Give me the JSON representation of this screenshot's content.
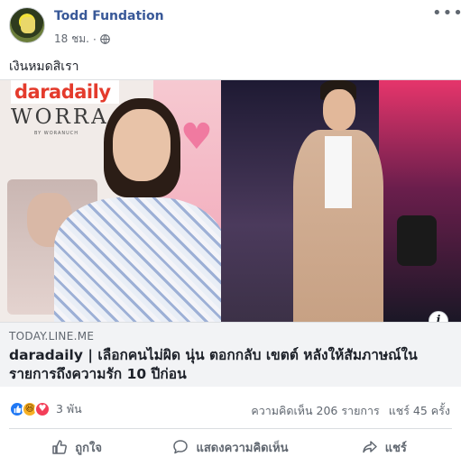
{
  "post": {
    "author": "Todd Fundation",
    "time": "18 ชม.",
    "separator": "·",
    "status_text": "เงินหมดสิเรา",
    "more_label": "•••"
  },
  "link_preview": {
    "image_logo": "daradaily",
    "image_brand": "WORRA",
    "image_brand_sub": "BY WORANUCH",
    "domain": "TODAY.LINE.ME",
    "headline": "daradaily | เลือกคนไม่ผิด นุ่น ตอกกลับ เขตต์ หลังให้สัมภาษณ์ในรายการถึงความรัก 10 ปีก่อน",
    "info_label": "i"
  },
  "reactions": {
    "count": "3 พัน",
    "types": [
      "like",
      "haha",
      "love"
    ],
    "comments": "ความคิดเห็น 206 รายการ",
    "shares": "แชร์ 45 ครั้ง"
  },
  "actions": {
    "like": "ถูกใจ",
    "comment": "แสดงความคิดเห็น",
    "share": "แชร์"
  },
  "colors": {
    "author_link": "#385898",
    "meta_gray": "#616770",
    "like_blue": "#2078f4",
    "love_red": "#f33e58",
    "haha_yellow": "#f7b125"
  }
}
